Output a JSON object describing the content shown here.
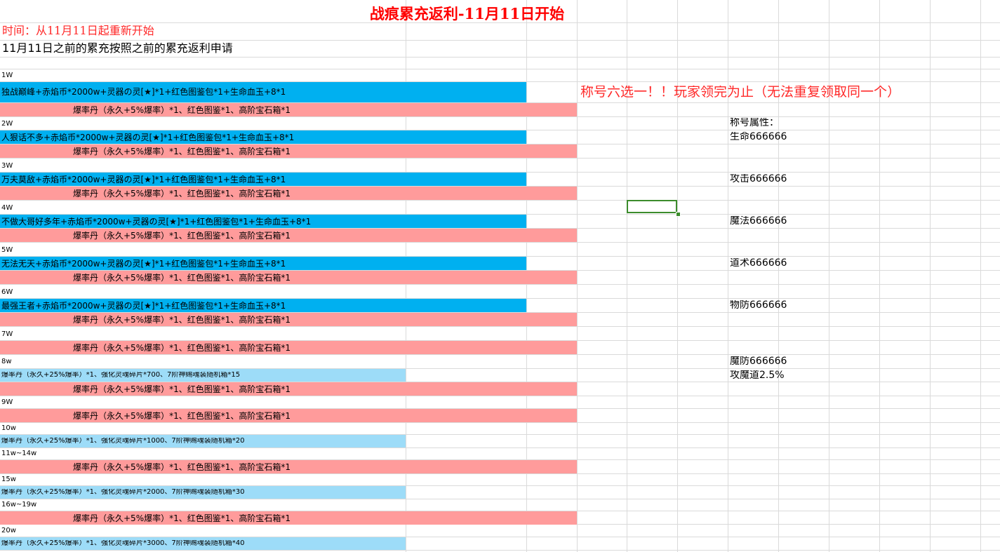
{
  "title": "战痕累充返利-11月11日开始",
  "time_line": "时间：从11月11日起重新开始",
  "note_line": "11月11日之前的累充按照之前的累充返利申请",
  "title_choice_note": "称号六选一！！玩家领完为止（无法重复领取同一个）",
  "attributes": {
    "header": "称号属性：",
    "life": "生命666666",
    "attack": "攻击666666",
    "magic": "魔法666666",
    "taoism": "道术666666",
    "phys_def": "物防666666",
    "magic_def": "魔防666666",
    "atk_magic_tao": "攻魔道2.5%"
  },
  "tiers": {
    "t1": {
      "label": "1W",
      "reward_a": "独战巅峰+赤焰币*2000w+灵器の灵[★]*1+红色图鉴包*1+生命血玉+8*1",
      "reward_b": "爆率丹（永久+5%爆率）*1、红色图鉴*1、高阶宝石箱*1"
    },
    "t2": {
      "label": "2W",
      "reward_a": "人狠话不多+赤焰币*2000w+灵器の灵[★]*1+红色图鉴包*1+生命血玉+8*1",
      "reward_b": "爆率丹（永久+5%爆率）*1、红色图鉴*1、高阶宝石箱*1"
    },
    "t3": {
      "label": "3W",
      "reward_a": "万夫莫敌+赤焰币*2000w+灵器の灵[★]*1+红色图鉴包*1+生命血玉+8*1",
      "reward_b": "爆率丹（永久+5%爆率）*1、红色图鉴*1、高阶宝石箱*1"
    },
    "t4": {
      "label": "4W",
      "reward_a": "不做大哥好多年+赤焰币*2000w+灵器の灵[★]*1+红色图鉴包*1+生命血玉+8*1",
      "reward_b": "爆率丹（永久+5%爆率）*1、红色图鉴*1、高阶宝石箱*1"
    },
    "t5": {
      "label": "5W",
      "reward_a": "无法无天+赤焰币*2000w+灵器の灵[★]*1+红色图鉴包*1+生命血玉+8*1",
      "reward_b": "爆率丹（永久+5%爆率）*1、红色图鉴*1、高阶宝石箱*1"
    },
    "t6": {
      "label": "6W",
      "reward_a": "最强王者+赤焰币*2000w+灵器の灵[★]*1+红色图鉴包*1+生命血玉+8*1",
      "reward_b": "爆率丹（永久+5%爆率）*1、红色图鉴*1、高阶宝石箱*1"
    },
    "t7": {
      "label": "7W",
      "reward_b": "爆率丹（永久+5%爆率）*1、红色图鉴*1、高阶宝石箱*1"
    },
    "t8": {
      "label": "8w",
      "reward_a": "爆率丹（永久+25%爆率）*1、强化灵魂碎片*700、7阶神赐魂装随机箱*15",
      "reward_b": "爆率丹（永久+5%爆率）*1、红色图鉴*1、高阶宝石箱*1"
    },
    "t9": {
      "label": "9W",
      "reward_b": "爆率丹（永久+5%爆率）*1、红色图鉴*1、高阶宝石箱*1"
    },
    "t10": {
      "label": "10w",
      "reward_a": "爆率丹（永久+25%爆率）*1、强化灵魂碎片*1000、7阶神赐魂装随机箱*20"
    },
    "t11": {
      "label": "11w~14w",
      "reward_b": "爆率丹（永久+5%爆率）*1、红色图鉴*1、高阶宝石箱*1"
    },
    "t15": {
      "label": "15w",
      "reward_a": "爆率丹（永久+25%爆率）*1、强化灵魂碎片*2000、7阶神赐魂装随机箱*30"
    },
    "t16": {
      "label": "16w~19w",
      "reward_b": "爆率丹（永久+5%爆率）*1、红色图鉴*1、高阶宝石箱*1"
    },
    "t20": {
      "label": "20w",
      "reward_a": "爆率丹（永久+25%爆率）*1、强化灵魂碎片*3000、7阶神赐魂装随机箱*40"
    }
  }
}
